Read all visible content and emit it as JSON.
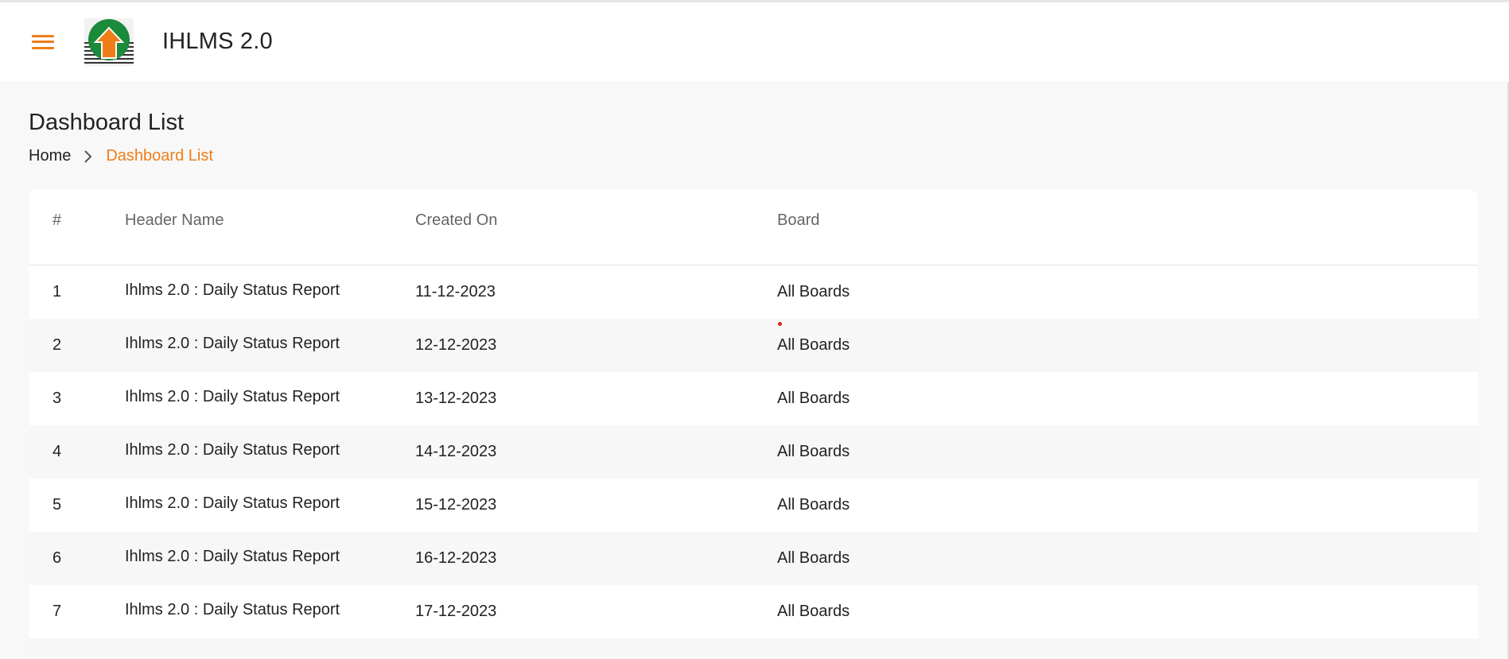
{
  "app": {
    "title": "IHLMS 2.0",
    "logo_icon": "house-upload-logo",
    "accent_color": "#ef7d18"
  },
  "page": {
    "title": "Dashboard List"
  },
  "breadcrumb": {
    "home": "Home",
    "current": "Dashboard List"
  },
  "table": {
    "columns": [
      "#",
      "Header Name",
      "Created On",
      "Board"
    ],
    "rows": [
      {
        "num": "1",
        "name": "Ihlms 2.0 : Daily Status Report",
        "created": "11-12-2023",
        "board": "All Boards"
      },
      {
        "num": "2",
        "name": "Ihlms 2.0 : Daily Status Report",
        "created": "12-12-2023",
        "board": "All Boards"
      },
      {
        "num": "3",
        "name": "Ihlms 2.0 : Daily Status Report",
        "created": "13-12-2023",
        "board": "All Boards"
      },
      {
        "num": "4",
        "name": "Ihlms 2.0 : Daily Status Report",
        "created": "14-12-2023",
        "board": "All Boards"
      },
      {
        "num": "5",
        "name": "Ihlms 2.0 : Daily Status Report",
        "created": "15-12-2023",
        "board": "All Boards"
      },
      {
        "num": "6",
        "name": "Ihlms 2.0 : Daily Status Report",
        "created": "16-12-2023",
        "board": "All Boards"
      },
      {
        "num": "7",
        "name": "Ihlms 2.0 : Daily Status Report",
        "created": "17-12-2023",
        "board": "All Boards"
      }
    ]
  }
}
